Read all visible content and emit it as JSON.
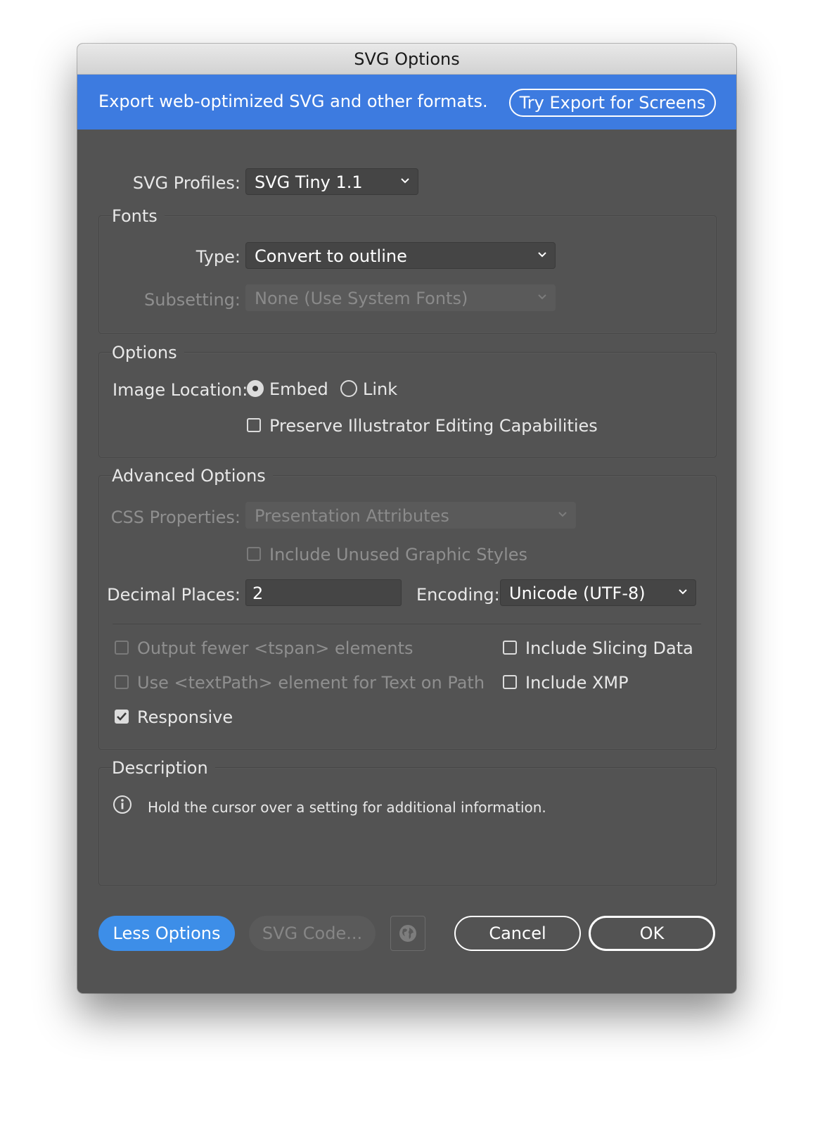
{
  "window": {
    "title": "SVG Options"
  },
  "banner": {
    "message": "Export web-optimized SVG and other formats.",
    "button_label": "Try Export for Screens"
  },
  "profiles": {
    "label": "SVG Profiles:",
    "value": "SVG Tiny 1.1"
  },
  "fonts": {
    "title": "Fonts",
    "type_label": "Type:",
    "type_value": "Convert to outline",
    "subsetting_label": "Subsetting:",
    "subsetting_value": "None (Use System Fonts)"
  },
  "options": {
    "title": "Options",
    "image_location_label": "Image Location:",
    "embed_label": "Embed",
    "link_label": "Link",
    "image_location_selected": "Embed",
    "preserve_label": "Preserve Illustrator Editing Capabilities",
    "preserve_checked": false
  },
  "advanced": {
    "title": "Advanced Options",
    "css_label": "CSS Properties:",
    "css_value": "Presentation Attributes",
    "unused_styles_label": "Include Unused Graphic Styles",
    "decimal_label": "Decimal Places:",
    "decimal_value": "2",
    "encoding_label": "Encoding:",
    "encoding_value": "Unicode (UTF-8)",
    "tspan_label": "Output fewer <tspan> elements",
    "textpath_label": "Use <textPath> element for Text on Path",
    "responsive_label": "Responsive",
    "responsive_checked": true,
    "slicing_label": "Include Slicing Data",
    "slicing_checked": false,
    "xmp_label": "Include XMP",
    "xmp_checked": false
  },
  "description": {
    "title": "Description",
    "text": "Hold the cursor over a setting for additional information."
  },
  "footer": {
    "less_options": "Less Options",
    "svg_code": "SVG Code...",
    "cancel": "Cancel",
    "ok": "OK"
  },
  "colors": {
    "dialog_bg": "#535353",
    "banner_bg": "#3d7be0",
    "primary_button": "#3d8ee8"
  },
  "icons": {
    "dropdown": "chevron-down-icon",
    "info": "info-icon",
    "globe": "globe-icon",
    "check": "checkmark-icon"
  }
}
